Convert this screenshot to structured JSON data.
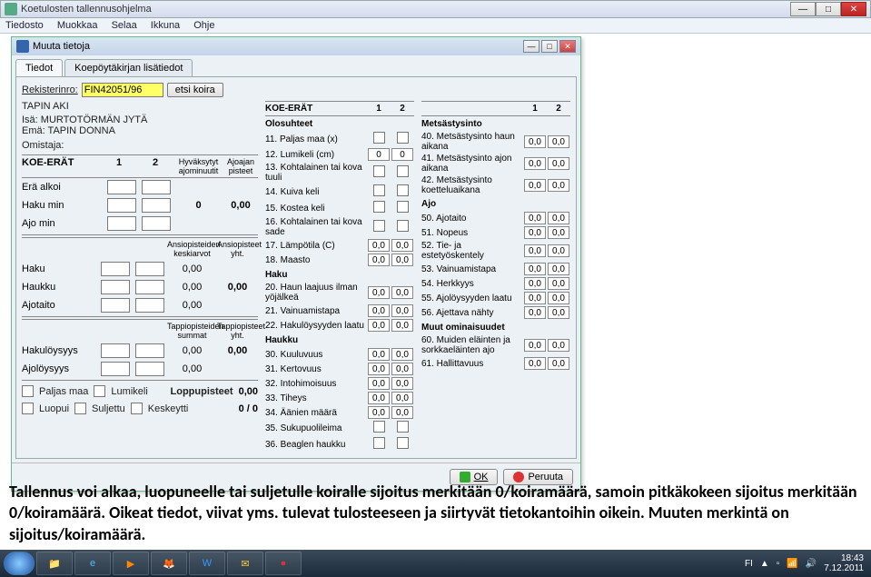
{
  "outer": {
    "title": "Koetulosten tallennusohjelma",
    "menu": [
      "Tiedosto",
      "Muokkaa",
      "Selaa",
      "Ikkuna",
      "Ohje"
    ]
  },
  "inner": {
    "title": "Muuta tietoja",
    "tabs": [
      "Tiedot",
      "Koepöytäkirjan lisätiedot"
    ]
  },
  "reg": {
    "label": "Rekisterinro:",
    "value": "FIN42051/96",
    "search": "etsi koira"
  },
  "dog": {
    "name": "TAPIN AKI",
    "sire_lbl": "Isä:",
    "sire": "MURTOTÖRMÄN JYTÄ",
    "dam_lbl": "Emä:",
    "dam": "TAPIN DONNA",
    "owner_lbl": "Omistaja:"
  },
  "left": {
    "hdr": [
      "KOE-ERÄT",
      "1",
      "2"
    ],
    "sub1": "Hyväksytyt ajominuutit",
    "sub2": "Ajoajan pisteet",
    "rows1": [
      "Erä alkoi",
      "Haku min",
      "Ajo min"
    ],
    "mid": {
      "c1": "0",
      "c2": "0,00"
    },
    "sub3": "Ansiopisteiden keskiarvot",
    "sub4": "Ansiopisteet yht.",
    "rows2": [
      [
        "Haku",
        "0,00"
      ],
      [
        "Haukku",
        "0,00"
      ],
      [
        "Ajotaito",
        "0,00"
      ]
    ],
    "yht2": "0,00",
    "sub5": "Tappiopisteiden summat",
    "sub6": "Tappiopisteet yht.",
    "rows3": [
      [
        "Hakulöysyys",
        "0,00"
      ],
      [
        "Ajolöysyys",
        "0,00"
      ]
    ],
    "yht3": "0,00",
    "ft": {
      "paljas": "Paljas maa",
      "lumi": "Lumikeli",
      "loppu": "Loppupisteet",
      "lv": "0,00",
      "luopui": "Luopui",
      "suljettu": "Suljettu",
      "kesk": "Keskeytti",
      "frac": "0 / 0"
    }
  },
  "mid": {
    "hdr": [
      "KOE-ERÄT",
      "1",
      "2"
    ],
    "olo": "Olosuhteet",
    "r11": "11. Paljas maa (x)",
    "r12": "12. Lumikeli (cm)",
    "v12a": "0",
    "v12b": "0",
    "r13": "13. Kohtalainen tai kova tuuli",
    "r14": "14. Kuiva keli",
    "r15": "15. Kostea keli",
    "r16": "16. Kohtalainen tai kova sade",
    "r17": "17. Lämpötila (C)",
    "v17a": "0,0",
    "v17b": "0,0",
    "r18": "18. Maasto",
    "v18a": "0,0",
    "v18b": "0,0",
    "haku": "Haku",
    "r20": "20. Haun laajuus ilman yöjälkeä",
    "r21": "21. Vainuamistapa",
    "r22": "22. Hakulöysyyden laatu",
    "haukku": "Haukku",
    "r30": "30. Kuuluvuus",
    "r31": "31. Kertovuus",
    "r32": "32. Intohimoisuus",
    "r33": "33. Tiheys",
    "r34": "34. Äänien määrä",
    "r35": "35. Sukupuolileima",
    "r36": "36. Beaglen haukku",
    "zz": "0,0"
  },
  "right": {
    "hdr": [
      "",
      "1",
      "2"
    ],
    "mets": "Metsästysinto",
    "r40": "40. Metsästysinto haun aikana",
    "r41": "41. Metsästysinto ajon aikana",
    "r42": "42. Metsästysinto koetteluaikana",
    "ajo": "Ajo",
    "r50": "50. Ajotaito",
    "r51": "51. Nopeus",
    "r52": "52. Tie- ja estetyöskentely",
    "r53": "53. Vainuamistapa",
    "r54": "54. Herkkyys",
    "r55": "55. Ajolöysyyden laatu",
    "r56": "56. Ajettava nähty",
    "muut": "Muut ominaisuudet",
    "r60": "60. Muiden eläinten ja sorkkaeläinten ajo",
    "r61": "61. Hallittavuus",
    "zz": "0,0"
  },
  "btns": {
    "ok": "OK",
    "cancel": "Peruuta"
  },
  "caption": "Tallennus voi alkaa, luopuneelle tai suljetulle koiralle sijoitus merkitään 0/koiramäärä, samoin pitkäkokeen sijoitus merkitään 0/koiramäärä. Oikeat tiedot, viivat yms. tulevat tulosteeseen ja siirtyvät tietokantoihin oikein. Muuten merkintä on sijoitus/koiramäärä.",
  "tray": {
    "lang": "FI",
    "time": "18:43",
    "date": "7.12.2011"
  }
}
